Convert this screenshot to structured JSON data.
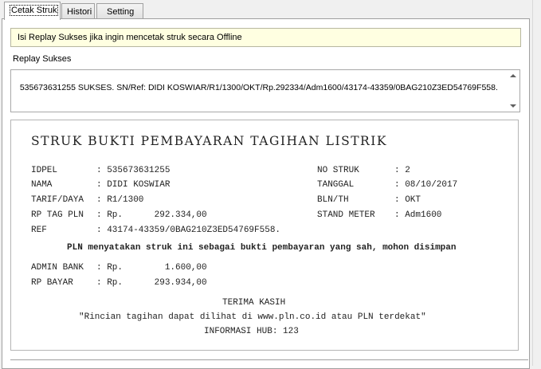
{
  "tabs": [
    "Cetak Struk",
    "Histori",
    "Setting"
  ],
  "info_text": "Isi Replay Sukses jika ingin mencetak struk secara Offline",
  "replay_label": "Replay Sukses",
  "replay_value": "535673631255 SUKSES. SN/Ref: DIDI KOSWIAR/R1/1300/OKT/Rp.292334/Adm1600/43174-43359/0BAG210Z3ED54769F558.",
  "receipt": {
    "title": "STRUK BUKTI PEMBAYARAN TAGIHAN LISTRIK",
    "left": [
      {
        "label": "IDPEL",
        "value": ": 535673631255"
      },
      {
        "label": "NAMA",
        "value": ": DIDI KOSWIAR"
      },
      {
        "label": "TARIF/DAYA",
        "value": ": R1/1300"
      },
      {
        "label": "RP TAG PLN",
        "value": ": Rp.      292.334,00"
      },
      {
        "label": "REF",
        "value": ": 43174-43359/0BAG210Z3ED54769F558."
      }
    ],
    "right": [
      {
        "label": "NO STRUK",
        "value": ": 2"
      },
      {
        "label": "TANGGAL",
        "value": ": 08/10/2017"
      },
      {
        "label": "BLN/TH",
        "value": ": OKT"
      },
      {
        "label": "STAND METER",
        "value": ": Adm1600"
      }
    ],
    "notice": "PLN menyatakan struk ini sebagai bukti pembayaran yang sah, mohon disimpan",
    "admin_label": "ADMIN BANK",
    "admin_value": ": Rp.        1.600,00",
    "bayar_label": "RP BAYAR",
    "bayar_value": ": Rp.      293.934,00",
    "thanks": "TERIMA KASIH",
    "rincian": "\"Rincian tagihan dapat dilihat di www.pln.co.id atau PLN terdekat\"",
    "hub": "INFORMASI HUB: 123"
  }
}
